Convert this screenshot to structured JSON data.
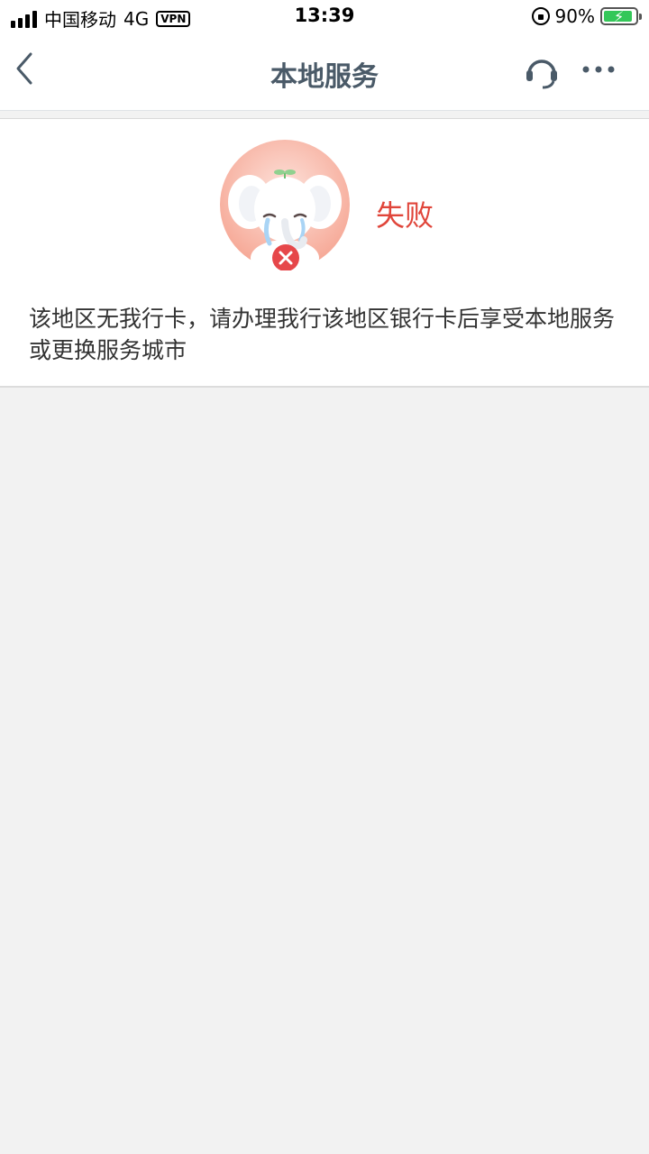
{
  "status_bar": {
    "carrier": "中国移动",
    "network": "4G",
    "vpn": "VPN",
    "time": "13:39",
    "battery": "90%",
    "battery_level": 0.9
  },
  "nav": {
    "title": "本地服务"
  },
  "result": {
    "status": "失败",
    "message": "该地区无我行卡，请办理我行该地区银行卡后享受本地服务或更换服务城市"
  },
  "colors": {
    "error": "#e0453a",
    "title": "#4a5a68",
    "background": "#f2f2f2"
  }
}
